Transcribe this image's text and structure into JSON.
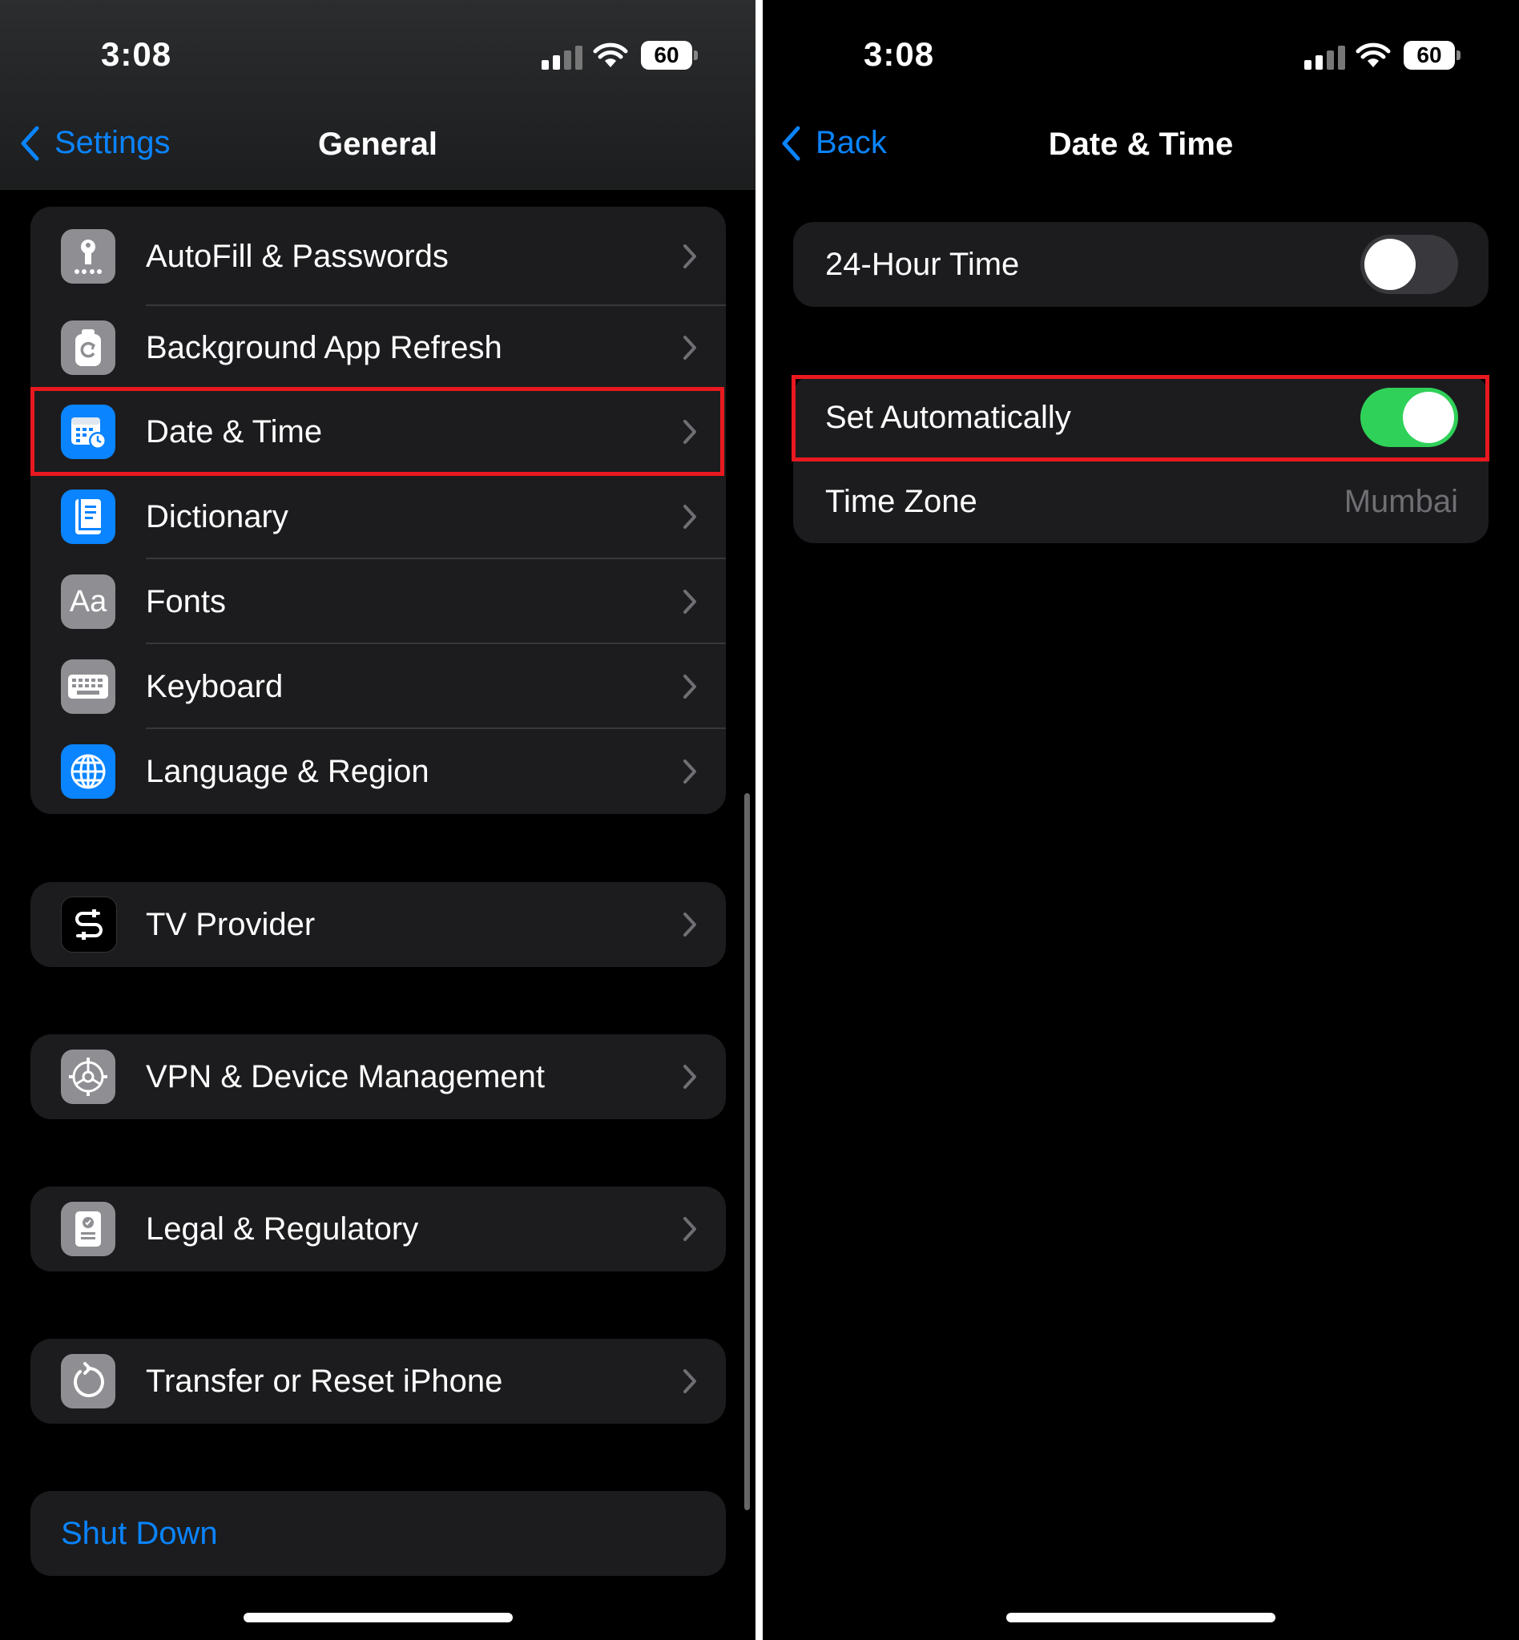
{
  "left": {
    "status": {
      "time": "3:08",
      "battery": "60"
    },
    "nav": {
      "back_label": "Settings",
      "title": "General"
    },
    "groups": [
      [
        {
          "label": "AutoFill & Passwords",
          "icon": "key-icon",
          "color": "#8e8e93"
        },
        {
          "label": "Background App Refresh",
          "icon": "refresh-icon",
          "color": "#8e8e93"
        },
        {
          "label": "Date & Time",
          "icon": "calendar-clock-icon",
          "color": "#0a84ff"
        },
        {
          "label": "Dictionary",
          "icon": "book-icon",
          "color": "#0a84ff"
        },
        {
          "label": "Fonts",
          "icon": "fonts-icon",
          "color": "#8e8e93",
          "icon_text": "Aa"
        },
        {
          "label": "Keyboard",
          "icon": "keyboard-icon",
          "color": "#8e8e93"
        },
        {
          "label": "Language & Region",
          "icon": "globe-icon",
          "color": "#0a84ff"
        }
      ],
      [
        {
          "label": "TV Provider",
          "icon": "tv-provider-icon",
          "color": "#000000"
        }
      ],
      [
        {
          "label": "VPN & Device Management",
          "icon": "gear-icon",
          "color": "#8e8e93"
        }
      ],
      [
        {
          "label": "Legal & Regulatory",
          "icon": "document-icon",
          "color": "#8e8e93"
        }
      ],
      [
        {
          "label": "Transfer or Reset iPhone",
          "icon": "reset-icon",
          "color": "#8e8e93"
        }
      ]
    ],
    "shutdown_label": "Shut Down"
  },
  "right": {
    "status": {
      "time": "3:08",
      "battery": "60"
    },
    "nav": {
      "back_label": "Back",
      "title": "Date & Time"
    },
    "rows": {
      "hour24": {
        "label": "24-Hour Time",
        "on": false
      },
      "auto": {
        "label": "Set Automatically",
        "on": true
      },
      "timezone": {
        "label": "Time Zone",
        "value": "Mumbai"
      }
    }
  },
  "colors": {
    "accent": "#0a84ff",
    "toggle_on": "#30d158",
    "highlight": "#e8191f",
    "cell_bg": "#1c1c1e"
  }
}
